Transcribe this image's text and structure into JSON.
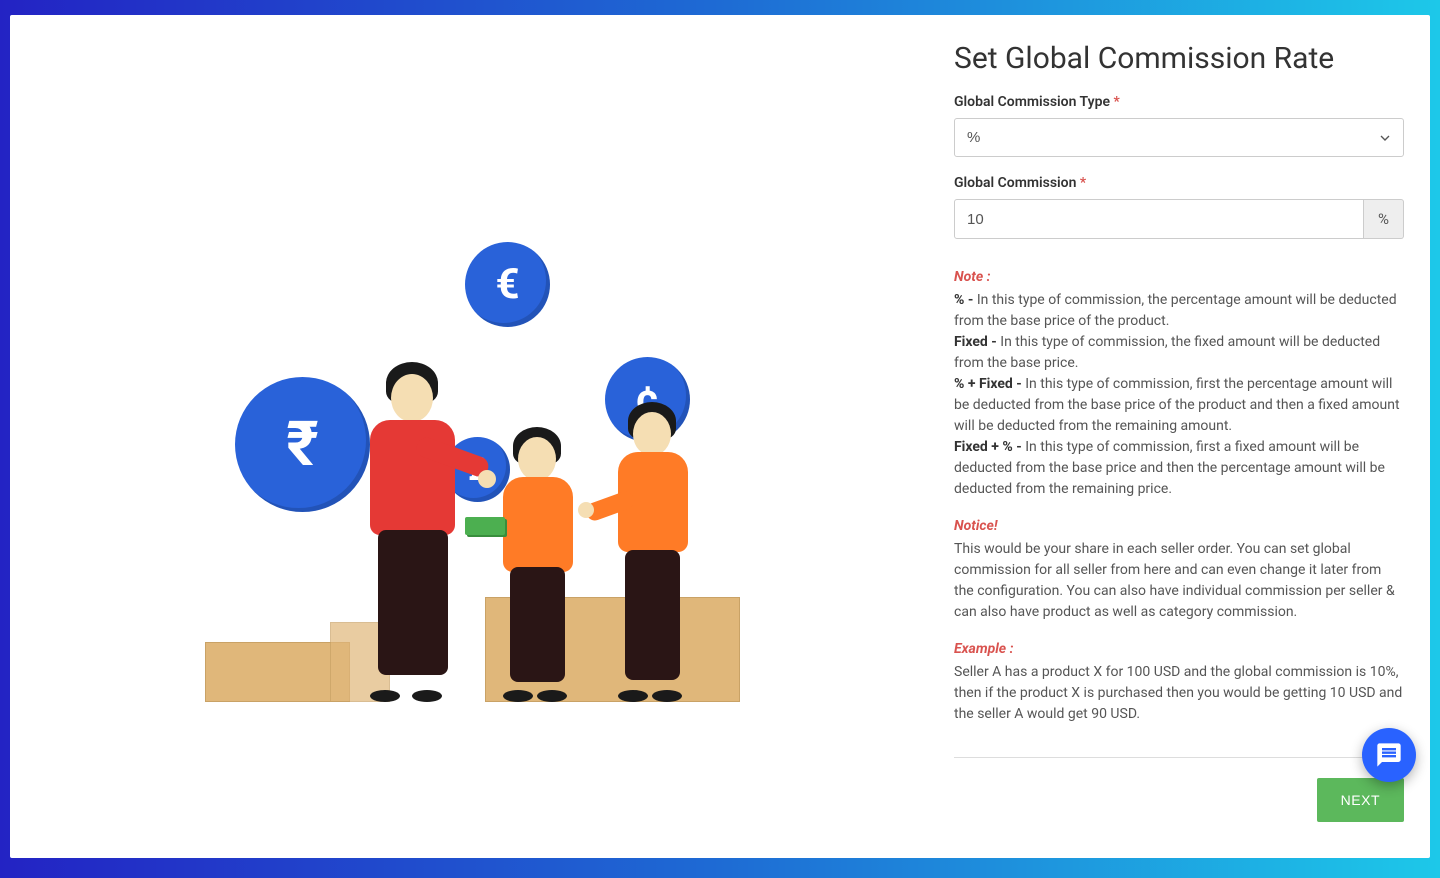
{
  "title": "Set Global Commission Rate",
  "form": {
    "type_label": "Global Commission Type",
    "type_value": "%",
    "commission_label": "Global Commission",
    "commission_value": "10",
    "commission_addon": "%",
    "required_mark": "*"
  },
  "notes": {
    "header": "Note :",
    "percent_label": "% - ",
    "percent_text": "In this type of commission, the percentage amount will be deducted from the base price of the product.",
    "fixed_label": "Fixed - ",
    "fixed_text": "In this type of commission, the fixed amount will be deducted from the base price.",
    "percent_fixed_label": "% + Fixed - ",
    "percent_fixed_text": "In this type of commission, first the percentage amount will be deducted from the base price of the product and then a fixed amount will be deducted from the remaining amount.",
    "fixed_percent_label": "Fixed + % - ",
    "fixed_percent_text": "In this type of commission, first a fixed amount will be deducted from the base price and then the percentage amount will be deducted from the remaining price."
  },
  "notice": {
    "header": "Notice!",
    "text": "This would be your share in each seller order. You can set global commission for all seller from here and can even change it later from the configuration. You can also have individual commission per seller & can also have product as well as category commission."
  },
  "example": {
    "header": "Example :",
    "text": "Seller A has a product X for 100 USD and the global commission is 10%, then if the product X is purchased then you would be getting 10 USD and the seller A would get 90 USD."
  },
  "buttons": {
    "next": "NEXT"
  },
  "icons": {
    "euro": "€",
    "rupee": "₹",
    "pound": "£",
    "cent": "¢"
  }
}
